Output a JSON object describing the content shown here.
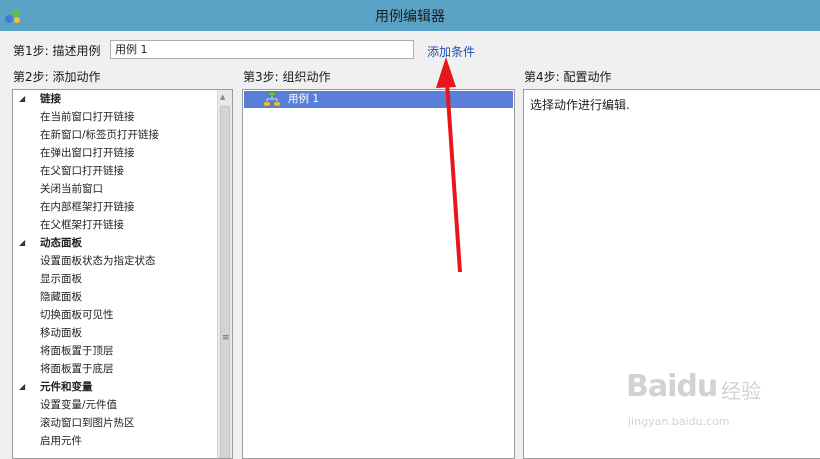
{
  "window": {
    "title": "用例编辑器"
  },
  "step1": {
    "label": "第1步: 描述用例",
    "usecase_name": "用例 1",
    "add_condition": "添加条件"
  },
  "step2": {
    "label": "第2步: 添加动作",
    "groups": [
      {
        "label": "链接",
        "items": [
          "在当前窗口打开链接",
          "在新窗口/标签页打开链接",
          "在弹出窗口打开链接",
          "在父窗口打开链接",
          "关闭当前窗口",
          "在内部框架打开链接",
          "在父框架打开链接"
        ]
      },
      {
        "label": "动态面板",
        "items": [
          "设置面板状态为指定状态",
          "显示面板",
          "隐藏面板",
          "切换面板可见性",
          "移动面板",
          "将面板置于顶层",
          "将面板置于底层"
        ]
      },
      {
        "label": "元件和变量",
        "items": [
          "设置变量/元件值",
          "滚动窗口到图片热区",
          "启用元件"
        ]
      }
    ]
  },
  "step3": {
    "label": "第3步: 组织动作",
    "cases": [
      {
        "label": "用例 1",
        "selected": true
      }
    ]
  },
  "step4": {
    "label": "第4步: 配置动作",
    "placeholder": "选择动作进行编辑."
  },
  "watermark": {
    "brand": "Baidu",
    "cn": "经验",
    "url": "jingyan.baidu.com"
  },
  "colors": {
    "titlebar": "#5aa3c6",
    "selection": "#5a7fd8",
    "link": "#1e4fb5",
    "annotation_arrow": "#e8151b"
  },
  "icons": {
    "app": "network-cubes-icon",
    "case": "usecase-icon",
    "expand": "triangle-down-icon"
  }
}
